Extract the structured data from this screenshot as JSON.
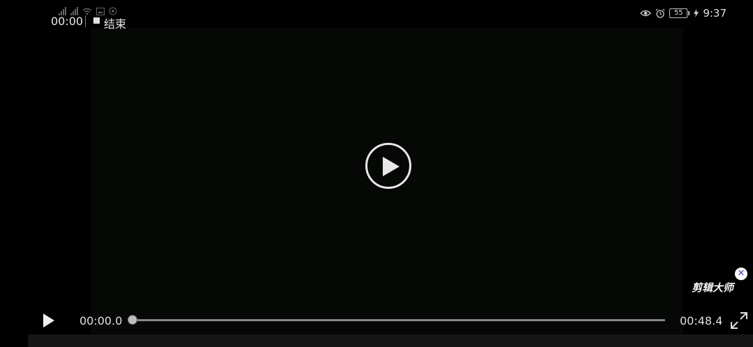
{
  "status_bar": {
    "recording_time": "00:00",
    "recording_end_label": "结束",
    "battery_level": "55",
    "clock": "9:37",
    "icons": [
      "signal-icon",
      "signal-icon",
      "wifi-icon",
      "image-icon",
      "chat-icon",
      "eye-icon",
      "alarm-icon",
      "battery-icon",
      "charging-icon"
    ]
  },
  "player": {
    "current_time": "00:00.0",
    "total_time": "00:48.4",
    "progress": 0.0,
    "center_button_icon": "play-circle-icon",
    "play_button_icon": "play-icon",
    "fullscreen_icon": "fullscreen-icon"
  },
  "watermark": {
    "text": "剪辑大师",
    "close_icon": "close-icon"
  },
  "colors": {
    "background": "#000000",
    "text": "#e6e6e6",
    "seek_track": "#8a8a8a",
    "watermark_close_accent": "#5a3bb0"
  }
}
